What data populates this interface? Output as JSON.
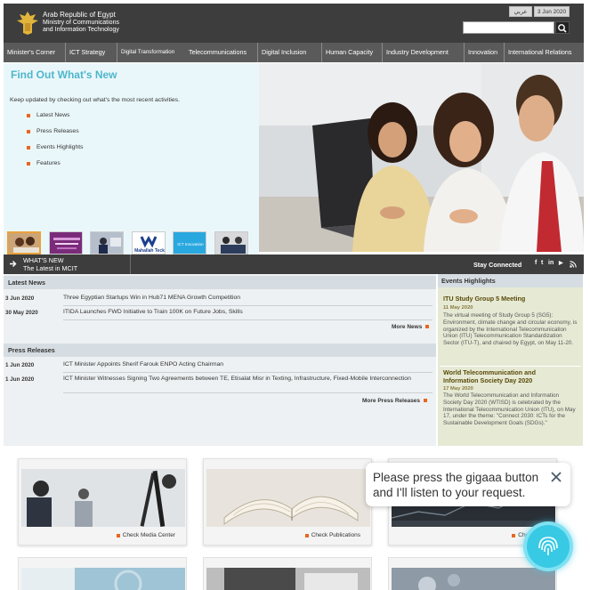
{
  "header": {
    "ministry_line1": "Arab Republic of Egypt",
    "ministry_line2": "Ministry of Communications",
    "ministry_line3": "and Information Technology",
    "lang_label": "عربي",
    "date_label": "3 Jun 2020",
    "search_placeholder": ""
  },
  "nav": {
    "items": [
      "Minister's Corner",
      "ICT Strategy",
      "Digital Transformation",
      "Telecommunications",
      "Digital Inclusion",
      "Human Capacity",
      "Industry Development",
      "Innovation",
      "International Relations"
    ]
  },
  "hero": {
    "title": "Find Out What's New",
    "description": "Keep updated by checking out what's the most recent activities.",
    "links": [
      "Latest News",
      "Press Releases",
      "Events Highlights",
      "Features"
    ],
    "thumb_logo_text": "Mahallah Teck",
    "thumb_sign_text": "ICT Innovation"
  },
  "whats_new_bar": {
    "title": "WHAT'S NEW",
    "subtitle": "The Latest in MCIT",
    "stay_connected": "Stay Connected",
    "social": [
      "f",
      "t",
      "in",
      "▶",
      "rss"
    ]
  },
  "latest_news": {
    "heading": "Latest News",
    "items": [
      {
        "date": "3 Jun 2020",
        "text": "Three Egyptian Startups Win in Hub71 MENA Growth Competition"
      },
      {
        "date": "30 May 2020",
        "text": "ITIDA Launches FWD Initiative to Train 100K on Future Jobs, Skills"
      }
    ],
    "more_label": "More News"
  },
  "press_releases": {
    "heading": "Press Releases",
    "items": [
      {
        "date": "1 Jun 2020",
        "text": "ICT Minister Appoints Sherif Farouk ENPO Acting Chairman"
      },
      {
        "date": "1 Jun 2020",
        "text": "ICT Minister Witnesses Signing Two Agreements between TE, Etisalat Misr in Texting, Infrastructure, Fixed-Mobile Interconnection"
      }
    ],
    "more_label": "More Press Releases"
  },
  "events": {
    "heading": "Events Highlights",
    "items": [
      {
        "title": "ITU Study Group 5 Meeting",
        "date": "11 May 2020",
        "text": "The virtual meeting of Study Group 5 (SG5): Environment, climate change and circular economy, is organized by the International Telecommunication Union (ITU) Telecommunication Standardization Sector (ITU-T), and chaired by Egypt, on May 11-20."
      },
      {
        "title": "World Telecommunication and Information Society Day 2020",
        "date": "17 May 2020",
        "text": "The World Telecommunication and Information Society Day 2020 (WTISD) is celebrated by the International Telecommunication Union (ITU), on May 17, under the theme: \"Connect 2030: ICTs for the Sustainable Development Goals (SDGs).\""
      }
    ]
  },
  "cards": [
    {
      "link": "Check Media Center"
    },
    {
      "link": "Check Publications"
    },
    {
      "link": "Check Indi"
    }
  ],
  "assistant": {
    "message": "Please press the gigaaa button and I'll listen to your request."
  },
  "colors": {
    "header_bg": "#3d3d3d",
    "nav_bg": "#5a5a5a",
    "accent_teal": "#4fb6cc",
    "bullet_orange": "#e8671e"
  }
}
